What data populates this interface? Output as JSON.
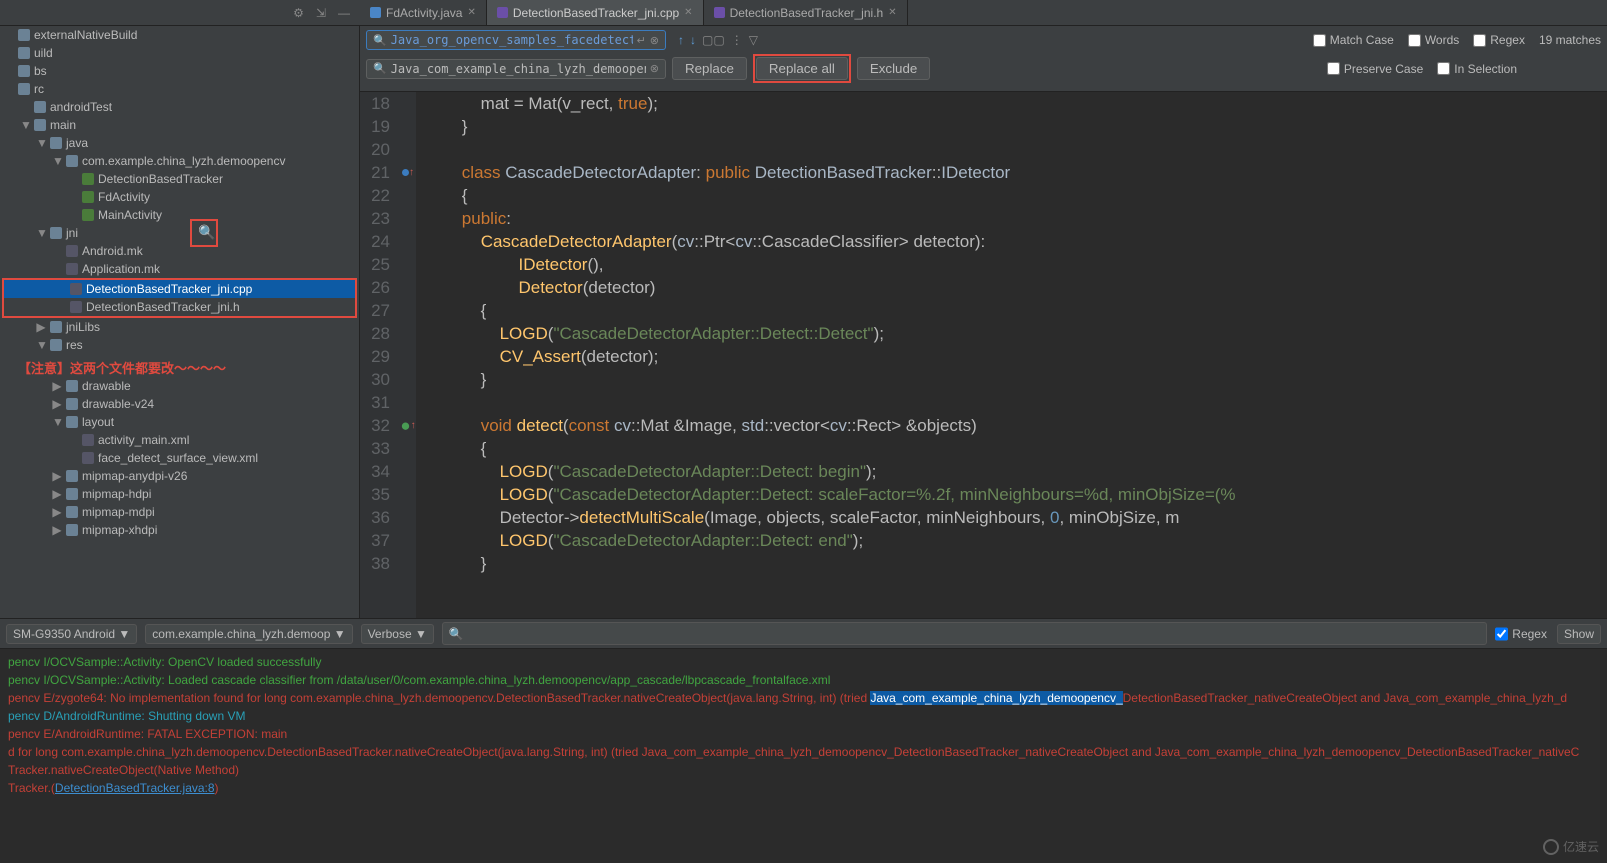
{
  "tabs": [
    {
      "label": "FdActivity.java",
      "icon": "java",
      "active": false
    },
    {
      "label": "DetectionBasedTracker_jni.cpp",
      "icon": "cpp",
      "active": true
    },
    {
      "label": "DetectionBasedTracker_jni.h",
      "icon": "h",
      "active": false
    }
  ],
  "project_tree": {
    "items": [
      {
        "indent": 0,
        "arrow": "",
        "icon": "folder",
        "label": "externalNativeBuild"
      },
      {
        "indent": 0,
        "arrow": "",
        "icon": "folder",
        "label": "uild"
      },
      {
        "indent": 0,
        "arrow": "",
        "icon": "folder",
        "label": "bs"
      },
      {
        "indent": 0,
        "arrow": "",
        "icon": "folder",
        "label": "rc"
      },
      {
        "indent": 1,
        "arrow": "",
        "icon": "folder",
        "label": "androidTest"
      },
      {
        "indent": 1,
        "arrow": "▼",
        "icon": "folder",
        "label": "main"
      },
      {
        "indent": 2,
        "arrow": "▼",
        "icon": "folder",
        "label": "java"
      },
      {
        "indent": 3,
        "arrow": "▼",
        "icon": "folder",
        "label": "com.example.china_lyzh.demoopencv"
      },
      {
        "indent": 4,
        "arrow": "",
        "icon": "class",
        "label": "DetectionBasedTracker"
      },
      {
        "indent": 4,
        "arrow": "",
        "icon": "class",
        "label": "FdActivity"
      },
      {
        "indent": 4,
        "arrow": "",
        "icon": "class",
        "label": "MainActivity"
      },
      {
        "indent": 2,
        "arrow": "▼",
        "icon": "folder",
        "label": "jni",
        "red_search_overlay": true
      },
      {
        "indent": 3,
        "arrow": "",
        "icon": "file",
        "label": "Android.mk"
      },
      {
        "indent": 3,
        "arrow": "",
        "icon": "file",
        "label": "Application.mk"
      }
    ],
    "boxed_items": [
      {
        "indent": 3,
        "arrow": "",
        "icon": "file",
        "label": "DetectionBasedTracker_jni.cpp",
        "selected": true
      },
      {
        "indent": 3,
        "arrow": "",
        "icon": "file",
        "label": "DetectionBasedTracker_jni.h"
      }
    ],
    "after_box": [
      {
        "indent": 2,
        "arrow": "▶",
        "icon": "folder",
        "label": "jniLibs"
      },
      {
        "indent": 2,
        "arrow": "▼",
        "icon": "folder",
        "label": "res"
      },
      {
        "indent": 3,
        "arrow": "▶",
        "icon": "folder",
        "label": "drawable"
      },
      {
        "indent": 3,
        "arrow": "▶",
        "icon": "folder",
        "label": "drawable-v24"
      },
      {
        "indent": 3,
        "arrow": "▼",
        "icon": "folder",
        "label": "layout"
      },
      {
        "indent": 4,
        "arrow": "",
        "icon": "file",
        "label": "activity_main.xml"
      },
      {
        "indent": 4,
        "arrow": "",
        "icon": "file",
        "label": "face_detect_surface_view.xml"
      },
      {
        "indent": 3,
        "arrow": "▶",
        "icon": "folder",
        "label": "mipmap-anydpi-v26"
      },
      {
        "indent": 3,
        "arrow": "▶",
        "icon": "folder",
        "label": "mipmap-hdpi"
      },
      {
        "indent": 3,
        "arrow": "▶",
        "icon": "folder",
        "label": "mipmap-mdpi"
      },
      {
        "indent": 3,
        "arrow": "▶",
        "icon": "folder",
        "label": "mipmap-xhdpi"
      }
    ],
    "red_note": "【注意】这两个文件都要改～～～～"
  },
  "search_replace": {
    "search_value": "Java_org_opencv_samples_facedetect_",
    "replace_value": "Java_com_example_china_lyzh_demoopencv_",
    "replace_btn": "Replace",
    "replace_all_btn": "Replace all",
    "exclude_btn": "Exclude",
    "match_case": "Match Case",
    "words": "Words",
    "regex": "Regex",
    "matches": "19 matches",
    "preserve_case": "Preserve Case",
    "in_selection": "In Selection"
  },
  "code": {
    "lines": [
      {
        "n": 18,
        "html": "            mat = Mat(v_rect, <span class='kw'>true</span>);"
      },
      {
        "n": 19,
        "html": "        }"
      },
      {
        "n": 20,
        "html": ""
      },
      {
        "n": 21,
        "html": "        <span class='kw'>class</span> <span class='ident'>CascadeDetectorAdapter</span>: <span class='kw'>public</span> <span class='ident'>DetectionBasedTracker</span>::<span class='ident'>IDetector</span>",
        "marker": "blue-red"
      },
      {
        "n": 22,
        "html": "        {"
      },
      {
        "n": 23,
        "html": "        <span class='kw'>public</span>:"
      },
      {
        "n": 24,
        "html": "            <span class='fn'>CascadeDetectorAdapter</span>(<span class='ident'>cv</span>::Ptr&lt;<span class='ident'>cv</span>::CascadeClassifier&gt; detector):"
      },
      {
        "n": 25,
        "html": "                    <span class='fn'>IDetector</span>(),"
      },
      {
        "n": 26,
        "html": "                    <span class='fn'>Detector</span>(detector)"
      },
      {
        "n": 27,
        "html": "            {"
      },
      {
        "n": 28,
        "html": "                <span class='fn'>LOGD</span>(<span class='str'>\"CascadeDetectorAdapter::Detect::Detect\"</span>);"
      },
      {
        "n": 29,
        "html": "                <span class='fn'>CV_Assert</span>(detector);"
      },
      {
        "n": 30,
        "html": "            }"
      },
      {
        "n": 31,
        "html": ""
      },
      {
        "n": 32,
        "html": "            <span class='kw'>void</span> <span class='fn'>detect</span>(<span class='kw'>const</span> <span class='ident'>cv</span>::Mat &amp;Image, <span class='ident'>std</span>::vector&lt;<span class='ident'>cv</span>::Rect&gt; &amp;objects)",
        "marker": "green-red"
      },
      {
        "n": 33,
        "html": "            {"
      },
      {
        "n": 34,
        "html": "                <span class='fn'>LOGD</span>(<span class='str'>\"CascadeDetectorAdapter::Detect: begin\"</span>);"
      },
      {
        "n": 35,
        "html": "                <span class='fn'>LOGD</span>(<span class='str'>\"CascadeDetectorAdapter::Detect: scaleFactor=%.2f, minNeighbours=%d, minObjSize=(%</span>"
      },
      {
        "n": 36,
        "html": "                Detector-&gt;<span class='fn'>detectMultiScale</span>(Image, objects, scaleFactor, minNeighbours, <span class='num'>0</span>, minObjSize, m"
      },
      {
        "n": 37,
        "html": "                <span class='fn'>LOGD</span>(<span class='str'>\"CascadeDetectorAdapter::Detect: end\"</span>);"
      },
      {
        "n": 38,
        "html": "            }"
      }
    ]
  },
  "logcat": {
    "device": "SM-G9350 Android ▼",
    "process": "com.example.china_lyzh.demoop ▼",
    "level": "Verbose ▼",
    "regex_label": "Regex",
    "show_label": "Show",
    "lines": [
      {
        "cls": "log-green",
        "text": "pencv I/OCVSample::Activity: OpenCV loaded successfully"
      },
      {
        "cls": "log-green",
        "text": "pencv I/OCVSample::Activity: Loaded cascade classifier from /data/user/0/com.example.china_lyzh.demoopencv/app_cascade/lbpcascade_frontalface.xml"
      },
      {
        "cls": "log-red",
        "text": "pencv E/zygote64: No implementation found for long com.example.china_lyzh.demoopencv.DetectionBasedTracker.nativeCreateObject(java.lang.String, int) (tried ",
        "hl": "Java_com_example_china_lyzh_demoopencv_",
        "tail": "DetectionBasedTracker_nativeCreateObject and Java_com_example_china_lyzh_d"
      },
      {
        "cls": "log-info",
        "text": "pencv D/AndroidRuntime: Shutting down VM"
      },
      {
        "cls": "log-red",
        "text": "pencv E/AndroidRuntime: FATAL EXCEPTION: main"
      },
      {
        "cls": "log-red",
        "text": ""
      },
      {
        "cls": "log-red",
        "text": "d for long com.example.china_lyzh.demoopencv.DetectionBasedTracker.nativeCreateObject(java.lang.String, int) (tried Java_com_example_china_lyzh_demoopencv_DetectionBasedTracker_nativeCreateObject and Java_com_example_china_lyzh_demoopencv_DetectionBasedTracker_nativeC"
      },
      {
        "cls": "log-red",
        "text": "Tracker.nativeCreateObject(Native Method)"
      },
      {
        "cls": "log-red",
        "text": "Tracker.<init>(",
        "link": "DetectionBasedTracker.java:8",
        ")": ")"
      }
    ]
  },
  "watermark": "亿速云"
}
